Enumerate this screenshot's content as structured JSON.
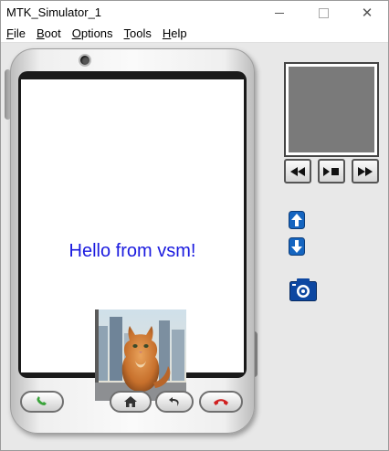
{
  "window": {
    "title": "MTK_Simulator_1"
  },
  "menu": [
    {
      "label": "File",
      "key": "F",
      "rest": "ile"
    },
    {
      "label": "Boot",
      "key": "B",
      "rest": "oot"
    },
    {
      "label": "Options",
      "key": "O",
      "rest": "ptions"
    },
    {
      "label": "Tools",
      "key": "T",
      "rest": "ools"
    },
    {
      "label": "Help",
      "key": "H",
      "rest": "elp"
    }
  ],
  "screen": {
    "message": "Hello from vsm!",
    "message_color": "#1a1adf",
    "image": "cat-photo"
  },
  "phone_buttons": [
    "call-icon",
    "home-icon",
    "back-icon",
    "end-call-icon"
  ],
  "media_controls": [
    "rewind-icon",
    "play-pause-icon",
    "fast-forward-icon"
  ],
  "side_controls": [
    "arrow-up-icon",
    "arrow-down-icon",
    "camera-icon"
  ]
}
